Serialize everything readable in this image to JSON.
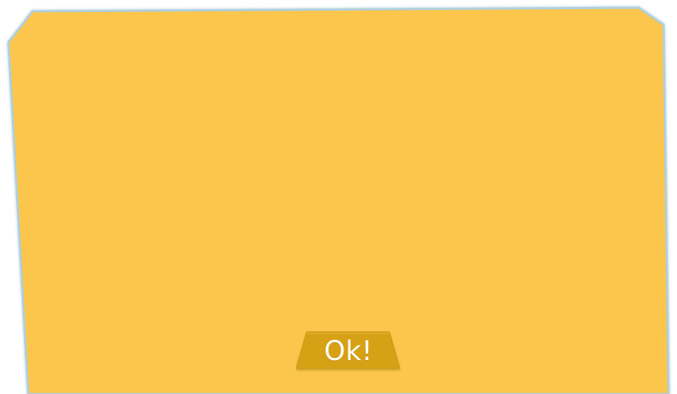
{
  "dialog": {
    "ok_label": "Ok!"
  },
  "colors": {
    "panel_fill": "#FBC64B",
    "panel_border": "#AFCFDD",
    "button_fill": "#D7A114",
    "button_shadow": "#B7860F",
    "button_text": "#FFFFFF",
    "background": "#FFFFFF"
  }
}
